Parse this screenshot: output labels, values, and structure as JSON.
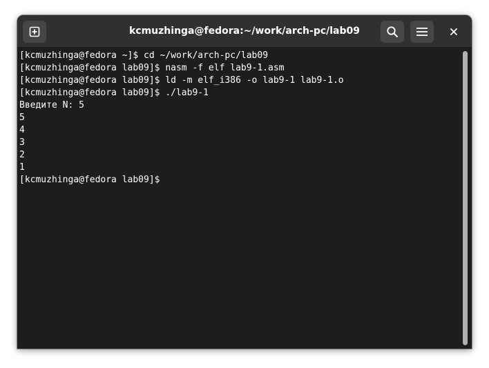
{
  "window": {
    "title": "kcmuzhinga@fedora:~/work/arch-pc/lab09"
  },
  "headerbar": {
    "new_tab_icon": "new-tab-icon",
    "search_icon": "search-icon",
    "menu_icon": "hamburger-menu-icon",
    "close_icon": "close-icon"
  },
  "terminal": {
    "lines": [
      "[kcmuzhinga@fedora ~]$ cd ~/work/arch-pc/lab09",
      "[kcmuzhinga@fedora lab09]$ nasm -f elf lab9-1.asm",
      "[kcmuzhinga@fedora lab09]$ ld -m elf_i386 -o lab9-1 lab9-1.o",
      "[kcmuzhinga@fedora lab09]$ ./lab9-1",
      "Введите N: 5",
      "5",
      "4",
      "3",
      "2",
      "1",
      "[kcmuzhinga@fedora lab09]$ "
    ]
  },
  "colors": {
    "headerbar_bg": "#303030",
    "terminal_bg": "#1d1d1d",
    "text": "#ffffff",
    "button_bg": "#464646",
    "scrollbar": "#b0b0b0"
  }
}
